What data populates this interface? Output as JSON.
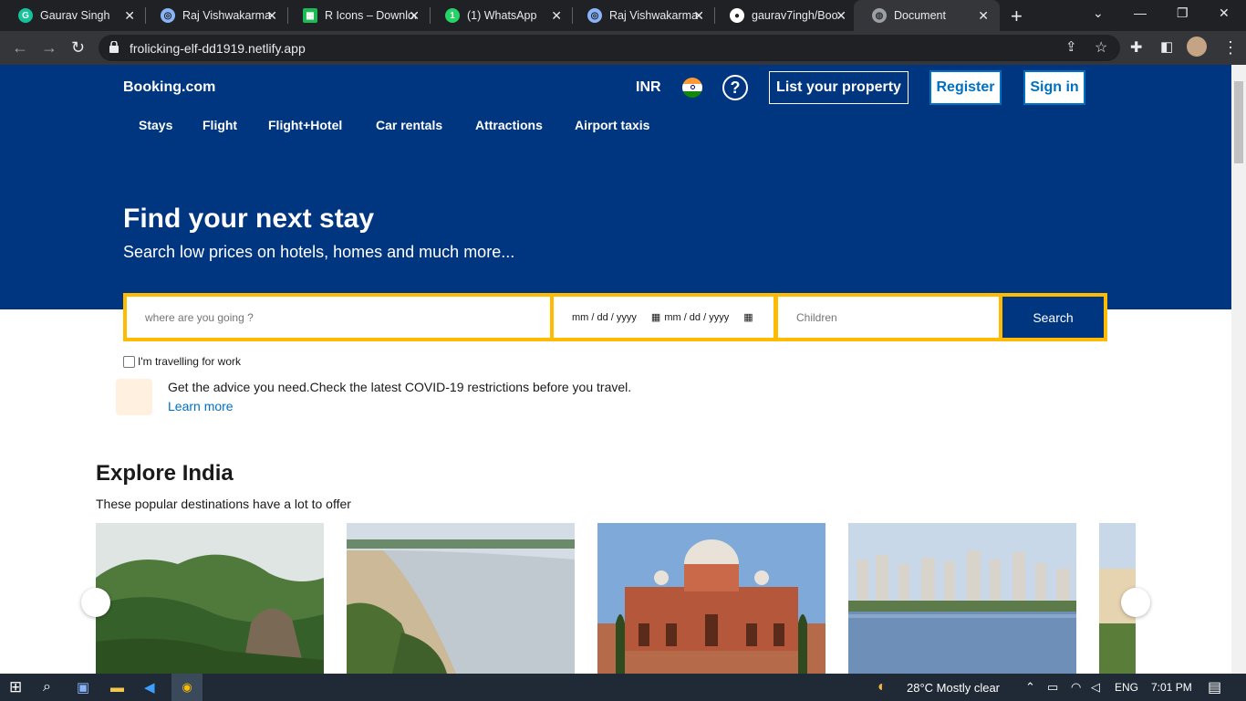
{
  "browser": {
    "tabs": [
      {
        "title": "Gaurav Singh",
        "icon": "grammarly-icon"
      },
      {
        "title": "Raj Vishwakarma",
        "icon": "globe-icon"
      },
      {
        "title": "R Icons – Download",
        "icon": "r-icons-icon"
      },
      {
        "title": "(1) WhatsApp",
        "icon": "whatsapp-icon"
      },
      {
        "title": "Raj Vishwakarma",
        "icon": "globe-icon"
      },
      {
        "title": "gaurav7ingh/Boo",
        "icon": "github-icon"
      },
      {
        "title": "Document",
        "icon": "globe-icon"
      }
    ],
    "url": "frolicking-elf-dd1919.netlify.app"
  },
  "header": {
    "brand": "Booking.com",
    "currency": "INR",
    "help": "?",
    "list_property": "List your property",
    "register": "Register",
    "sign_in": "Sign in",
    "nav": [
      "Stays",
      "Flight",
      "Flight+Hotel",
      "Car rentals",
      "Attractions",
      "Airport taxis"
    ]
  },
  "hero": {
    "title": "Find your next stay",
    "subtitle": "Search low prices on hotels, homes and much more..."
  },
  "search": {
    "destination_placeholder": "where are you going ?",
    "checkin_placeholder": "mm / dd / yyyy",
    "checkout_placeholder": "mm / dd / yyyy",
    "children_placeholder": "Children",
    "button": "Search"
  },
  "work_travel": "I'm travelling for work",
  "covid": {
    "text": "Get the advice you need.Check the latest COVID-19 restrictions before you travel.",
    "link": "Learn more"
  },
  "explore": {
    "title": "Explore India",
    "subtitle": "These popular destinations have a lot to offer"
  },
  "taskbar": {
    "weather": "28°C  Mostly clear",
    "language": "ENG",
    "time": "7:01 PM"
  },
  "colors": {
    "brand_blue": "#003580",
    "accent_yellow": "#febb02",
    "link_blue": "#0071c2"
  }
}
